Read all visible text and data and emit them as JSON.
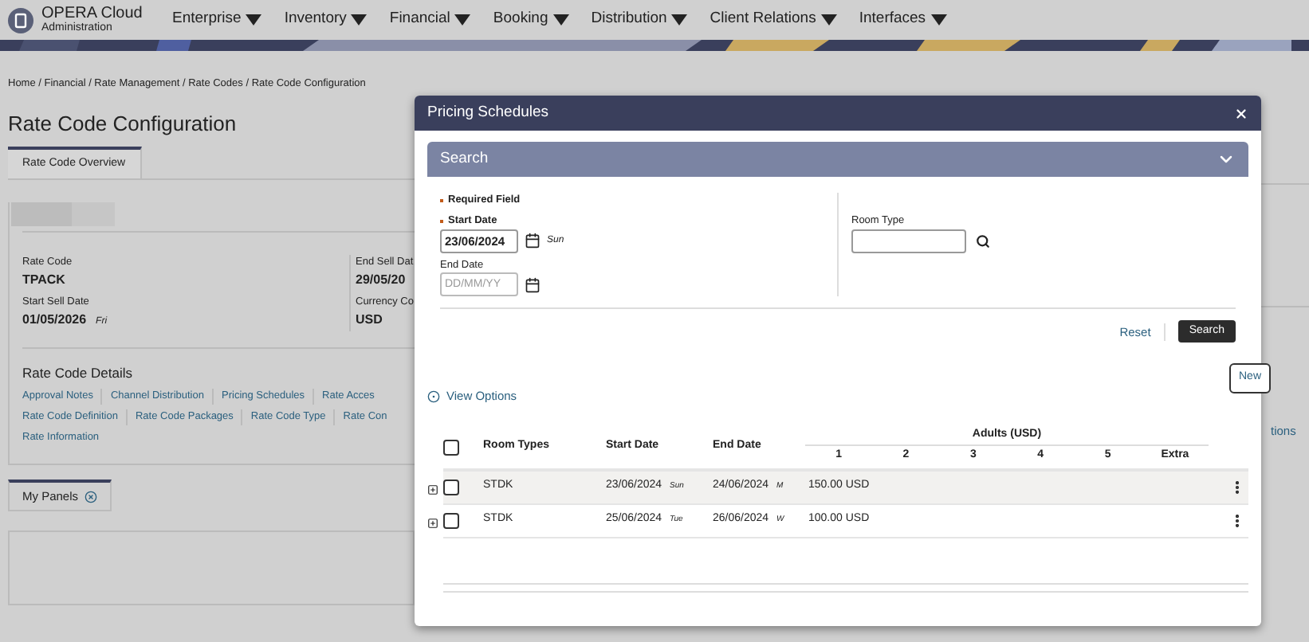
{
  "header": {
    "logo_title": "OPERA Cloud",
    "logo_subtitle": "Administration",
    "menus": [
      "Enterprise",
      "Inventory",
      "Financial",
      "Booking",
      "Distribution",
      "Client Relations",
      "Interfaces"
    ]
  },
  "breadcrumb": "Home / Financial / Rate Management / Rate Codes / Rate Code Configuration",
  "page_title": "Rate Code Configuration",
  "tabs": [
    {
      "label": "Rate Code Overview",
      "selected": true
    }
  ],
  "overview": {
    "fields_left": [
      {
        "label": "Rate Code",
        "value": "TPACK"
      },
      {
        "label": "Start Sell Date",
        "value": "01/05/2026",
        "day": "Fri"
      }
    ],
    "fields_right": [
      {
        "label": "End Sell Dat",
        "value": "29/05/20"
      },
      {
        "label": "Currency Co",
        "value": "USD"
      }
    ]
  },
  "details": {
    "title": "Rate Code Details",
    "link_rows": [
      [
        "Approval Notes",
        "Channel Distribution",
        "Pricing Schedules",
        "Rate Acces"
      ],
      [
        "Rate Code Definition",
        "Rate Code Packages",
        "Rate Code Type",
        "Rate Con"
      ],
      [
        "Rate Information"
      ]
    ]
  },
  "side_link": "tions",
  "my_panels": {
    "label": "My Panels",
    "selected": true
  },
  "modal": {
    "title": "Pricing Schedules",
    "search": {
      "title": "Search",
      "expanded": true,
      "required_note": "Required Field",
      "start_date": {
        "label": "Start Date",
        "value": "23/06/2024",
        "day": "Sun"
      },
      "end_date": {
        "label": "End Date",
        "placeholder": "DD/MM/YY"
      },
      "room_type": {
        "label": "Room Type"
      },
      "reset": "Reset",
      "search_button": "Search"
    },
    "view_options": "View Options",
    "table": {
      "all_checked": false,
      "columns": [
        "Room Types",
        "Start Date",
        "End Date"
      ],
      "group": "Adults (USD)",
      "sub_columns": [
        "1",
        "2",
        "3",
        "4",
        "5",
        "Extra"
      ],
      "rows": [
        {
          "room_type": "STDK",
          "start": "23/06/2024",
          "start_day": "Sun",
          "end": "24/06/2024",
          "end_day": "M",
          "values": [
            "150.00 USD"
          ],
          "checked": false,
          "selected": true
        },
        {
          "room_type": "STDK",
          "start": "25/06/2024",
          "start_day": "Tue",
          "end": "26/06/2024",
          "end_day": "W",
          "values": [
            "100.00 USD"
          ],
          "checked": false,
          "selected": false
        }
      ]
    }
  },
  "tooltip": "New"
}
